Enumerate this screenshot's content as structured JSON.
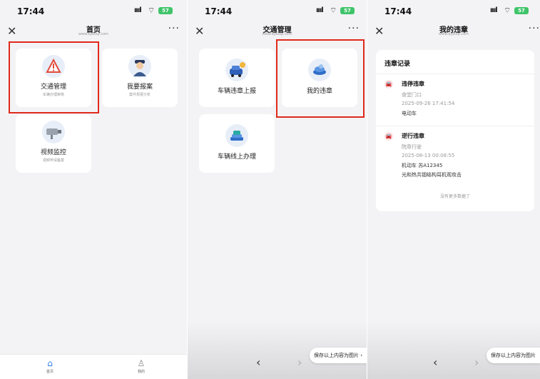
{
  "status_bar": {
    "time": "17:44",
    "battery": "57"
  },
  "screens": {
    "home": {
      "title": "首页",
      "subtitle": "www.ejdsxp.com",
      "cards": [
        {
          "label": "交通管理",
          "sub": "车辆办理审核",
          "icon": "warning-icon"
        },
        {
          "label": "我要报案",
          "sub": "案件规报分析",
          "icon": "police-icon"
        },
        {
          "label": "视频监控",
          "sub": "视频申请备案",
          "icon": "camera-icon"
        }
      ],
      "tabs": [
        {
          "label": "首页",
          "icon": "home-icon"
        },
        {
          "label": "我的",
          "icon": "user-icon"
        }
      ]
    },
    "traffic": {
      "title": "交通管理",
      "subtitle": "www.ejdsxp.com",
      "cards": [
        {
          "label": "车辆违章上报",
          "icon": "car-report-icon"
        },
        {
          "label": "我的违章",
          "icon": "violation-icon"
        },
        {
          "label": "车辆线上办理",
          "icon": "online-service-icon"
        }
      ],
      "save_button": "保存以上内容为图片 ›"
    },
    "violations": {
      "title": "我的违章",
      "subtitle": "www.ejdsxp.com",
      "section_title": "违章记录",
      "records": [
        {
          "type": "违停违章",
          "location": "食堂门口",
          "time": "2025-09-26 17:41:54",
          "vehicle": "电动车"
        },
        {
          "type": "逆行违章",
          "location": "院章行驶",
          "time": "2025-08-13 00:08:55",
          "vehicle": "机动车  苏A12345",
          "note": "光和热共铟结构耳机观攻击"
        }
      ],
      "no_more": "没有更多数据了",
      "save_button": "保存以上内容为图片"
    }
  },
  "colors": {
    "highlight": "#e0291b",
    "accent": "#2f7ae5",
    "bg": "#f3f3f5"
  }
}
